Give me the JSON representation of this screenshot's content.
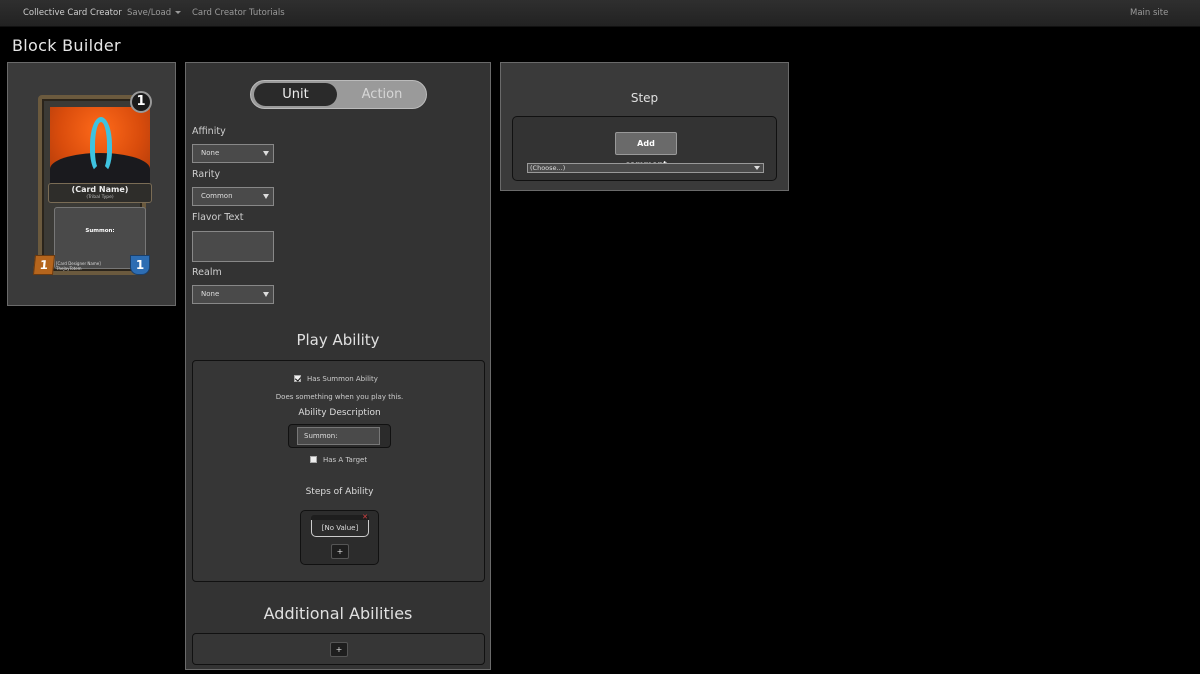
{
  "navbar": {
    "brand": "Collective Card Creator",
    "save_load": "Save/Load",
    "tutorials": "Card Creator Tutorials",
    "main_site": "Main site"
  },
  "page": {
    "title": "Block Builder"
  },
  "card": {
    "cost": "1",
    "name": "(Card Name)",
    "tribe": "(Tribal Type)",
    "text": "Summon:",
    "attack": "1",
    "health": "1",
    "designer": "[Card Designer Name]",
    "designer_sub": "TheJayTotem"
  },
  "builder": {
    "toggle": {
      "unit": "Unit",
      "action": "Action",
      "selected": "Unit"
    },
    "affinity": {
      "label": "Affinity",
      "value": "None"
    },
    "rarity": {
      "label": "Rarity",
      "value": "Common"
    },
    "flavor": {
      "label": "Flavor Text",
      "value": ""
    },
    "realm": {
      "label": "Realm",
      "value": "None"
    },
    "play_ability": {
      "title": "Play Ability",
      "has_summon_label": "Has Summon Ability",
      "has_summon_checked": true,
      "summon_hint": "Does something when you play this.",
      "description_label": "Ability Description",
      "description_value": "Summon:",
      "has_target_label": "Has A Target",
      "has_target_checked": false,
      "steps_label": "Steps of Ability",
      "step_value": "[No Value]",
      "add_step": "+"
    },
    "additional": {
      "title": "Additional Abilities",
      "add": "+"
    }
  },
  "step_panel": {
    "title": "Step",
    "add_comment": "Add comment",
    "choose": "(Choose...)"
  }
}
